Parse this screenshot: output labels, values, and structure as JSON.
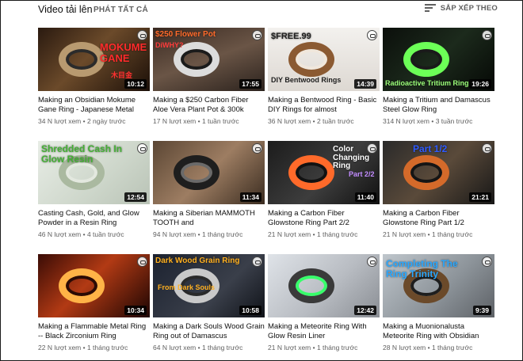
{
  "header": {
    "title": "Video tải lên",
    "play_all": "PHÁT TẤT CẢ",
    "sort_label": "SẮP XẾP THEO"
  },
  "colors": {
    "meta_text": "#606060",
    "duration_bg": "#000000"
  },
  "videos": [
    {
      "title": "Making an Obsidian Mokume Gane Ring - Japanese Metal",
      "views": "34 N lượt xem",
      "age": "2 ngày trước",
      "duration": "10:12",
      "thumb_text": "MOKUME GANE",
      "thumb_subtext": "木目金"
    },
    {
      "title": "Making a $250 Carbon Fiber Aloe Vera Plant Pot & 300k",
      "views": "17 N lượt xem",
      "age": "1 tuần trước",
      "duration": "17:55",
      "thumb_text": "$250 Flower Pot",
      "thumb_subtext": "DiWHY?"
    },
    {
      "title": "Making a Bentwood Ring - Basic DIY Rings for almost",
      "views": "36 N lượt xem",
      "age": "2 tuần trước",
      "duration": "14:39",
      "thumb_text": "$FREE.99",
      "thumb_subtext": "DIY Bentwood Rings"
    },
    {
      "title": "Making a Tritium and Damascus Steel Glow Ring",
      "views": "314 N lượt xem",
      "age": "3 tuần trước",
      "duration": "19:26",
      "thumb_text": "Radioactive Tritium Ring",
      "thumb_subtext": ""
    },
    {
      "title": "Casting Cash, Gold, and Glow Powder in a Resin Ring",
      "views": "46 N lượt xem",
      "age": "4 tuần trước",
      "duration": "12:54",
      "thumb_text": "Shredded Cash In Glow Resin",
      "thumb_subtext": ""
    },
    {
      "title": "Making a Siberian MAMMOTH TOOTH and",
      "views": "94 N lượt xem",
      "age": "1 tháng trước",
      "duration": "11:34",
      "thumb_text": "",
      "thumb_subtext": ""
    },
    {
      "title": "Making a Carbon Fiber Glowstone Ring Part 2/2",
      "views": "21 N lượt xem",
      "age": "1 tháng trước",
      "duration": "11:40",
      "thumb_text": "Color Changing Ring",
      "thumb_subtext": "Part 2/2"
    },
    {
      "title": "Making a Carbon Fiber Glowstone Ring Part 1/2",
      "views": "21 N lượt xem",
      "age": "1 tháng trước",
      "duration": "21:21",
      "thumb_text": "Part 1/2",
      "thumb_subtext": ""
    },
    {
      "title": "Making a Flammable Metal Ring -- Black Zirconium Ring",
      "views": "22 N lượt xem",
      "age": "1 tháng trước",
      "duration": "10:34",
      "thumb_text": "",
      "thumb_subtext": ""
    },
    {
      "title": "Making a Dark Souls Wood Grain Ring out of Damascus",
      "views": "64 N lượt xem",
      "age": "1 tháng trước",
      "duration": "10:58",
      "thumb_text": "Dark Wood Grain Ring",
      "thumb_subtext": "From Dark Souls"
    },
    {
      "title": "Making a Meteorite Ring With Glow Resin Liner",
      "views": "21 N lượt xem",
      "age": "1 tháng trước",
      "duration": "12:42",
      "thumb_text": "",
      "thumb_subtext": ""
    },
    {
      "title": "Making a Muonionalusta Meteorite Ring with Obsidian",
      "views": "28 N lượt xem",
      "age": "1 tháng trước",
      "duration": "9:39",
      "thumb_text": "Completing The Ring Trinity",
      "thumb_subtext": ""
    }
  ]
}
